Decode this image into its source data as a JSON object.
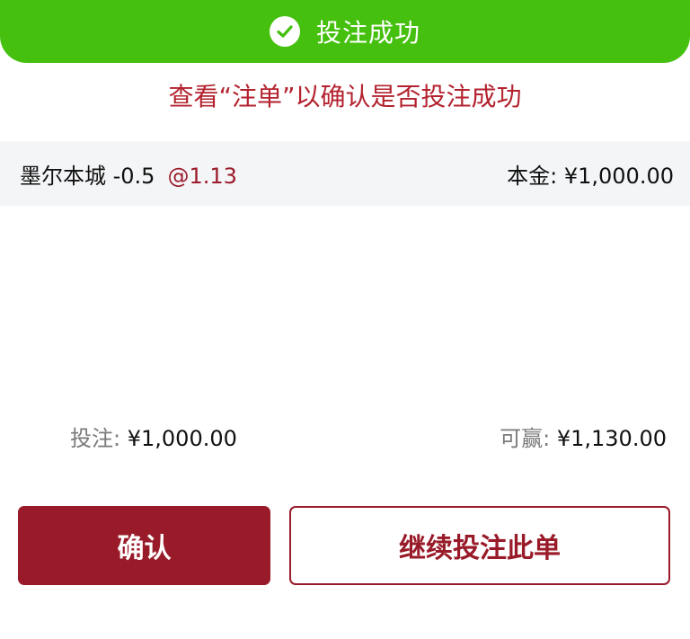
{
  "banner": {
    "text": "投注成功",
    "icon": "check-icon",
    "color": "#45c00e"
  },
  "notice": "查看“注单”以确认是否投注成功",
  "bet": {
    "selection": "墨尔本城 -0.5",
    "odds": "@1.13",
    "stake_label": "本金:",
    "stake_value": "¥1,000.00"
  },
  "summary": {
    "bet_label": "投注:",
    "bet_value": "¥1,000.00",
    "win_label": "可赢:",
    "win_value": "¥1,130.00"
  },
  "buttons": {
    "confirm_label": "确认",
    "repeat_label": "继续投注此单"
  },
  "colors": {
    "accent": "#991b2a",
    "success": "#45c00e",
    "notice_text": "#b3222e"
  }
}
